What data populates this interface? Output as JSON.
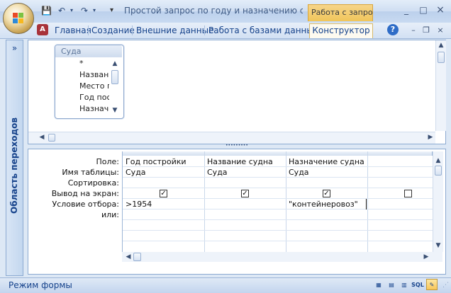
{
  "titlebar": {
    "title": "Простой запрос по году и назначению судна  Microsoft Access",
    "context_tab": "Работа с запросами",
    "minimize": "_",
    "maximize": "□",
    "close": "×"
  },
  "qat": {
    "save_icon": "💾",
    "undo_icon": "↶",
    "redo_icon": "↷",
    "customize_icon": "▾"
  },
  "ribbon": {
    "tabs": [
      "Главная",
      "Создание",
      "Внешние данные",
      "Работа с базами данных",
      "Конструктор"
    ],
    "help_icon": "?",
    "doc_minimize": "–",
    "doc_restore": "❐",
    "doc_close": "×"
  },
  "navpane": {
    "label": "Область переходов",
    "toggle": "»"
  },
  "table_box": {
    "name": "Суда",
    "fields": [
      "*",
      "Название судна",
      "Место постройки",
      "Год постройки",
      "Назначение судна"
    ]
  },
  "grid": {
    "row_labels": [
      "Поле:",
      "Имя таблицы:",
      "Сортировка:",
      "Вывод на экран:",
      "Условие отбора:",
      "или:"
    ],
    "columns": [
      {
        "field": "Год постройки",
        "table": "Суда",
        "sort": "",
        "show": true,
        "criteria": ">1954"
      },
      {
        "field": "Название судна",
        "table": "Суда",
        "sort": "",
        "show": true,
        "criteria": ""
      },
      {
        "field": "Назначение судна",
        "table": "Суда",
        "sort": "",
        "show": true,
        "criteria": "\"контейнеровоз\""
      },
      {
        "field": "",
        "table": "",
        "sort": "",
        "show": false,
        "criteria": ""
      }
    ]
  },
  "statusbar": {
    "text": "Режим формы",
    "views": [
      "▦",
      "▤",
      "▥",
      "SQL",
      "✎"
    ]
  }
}
